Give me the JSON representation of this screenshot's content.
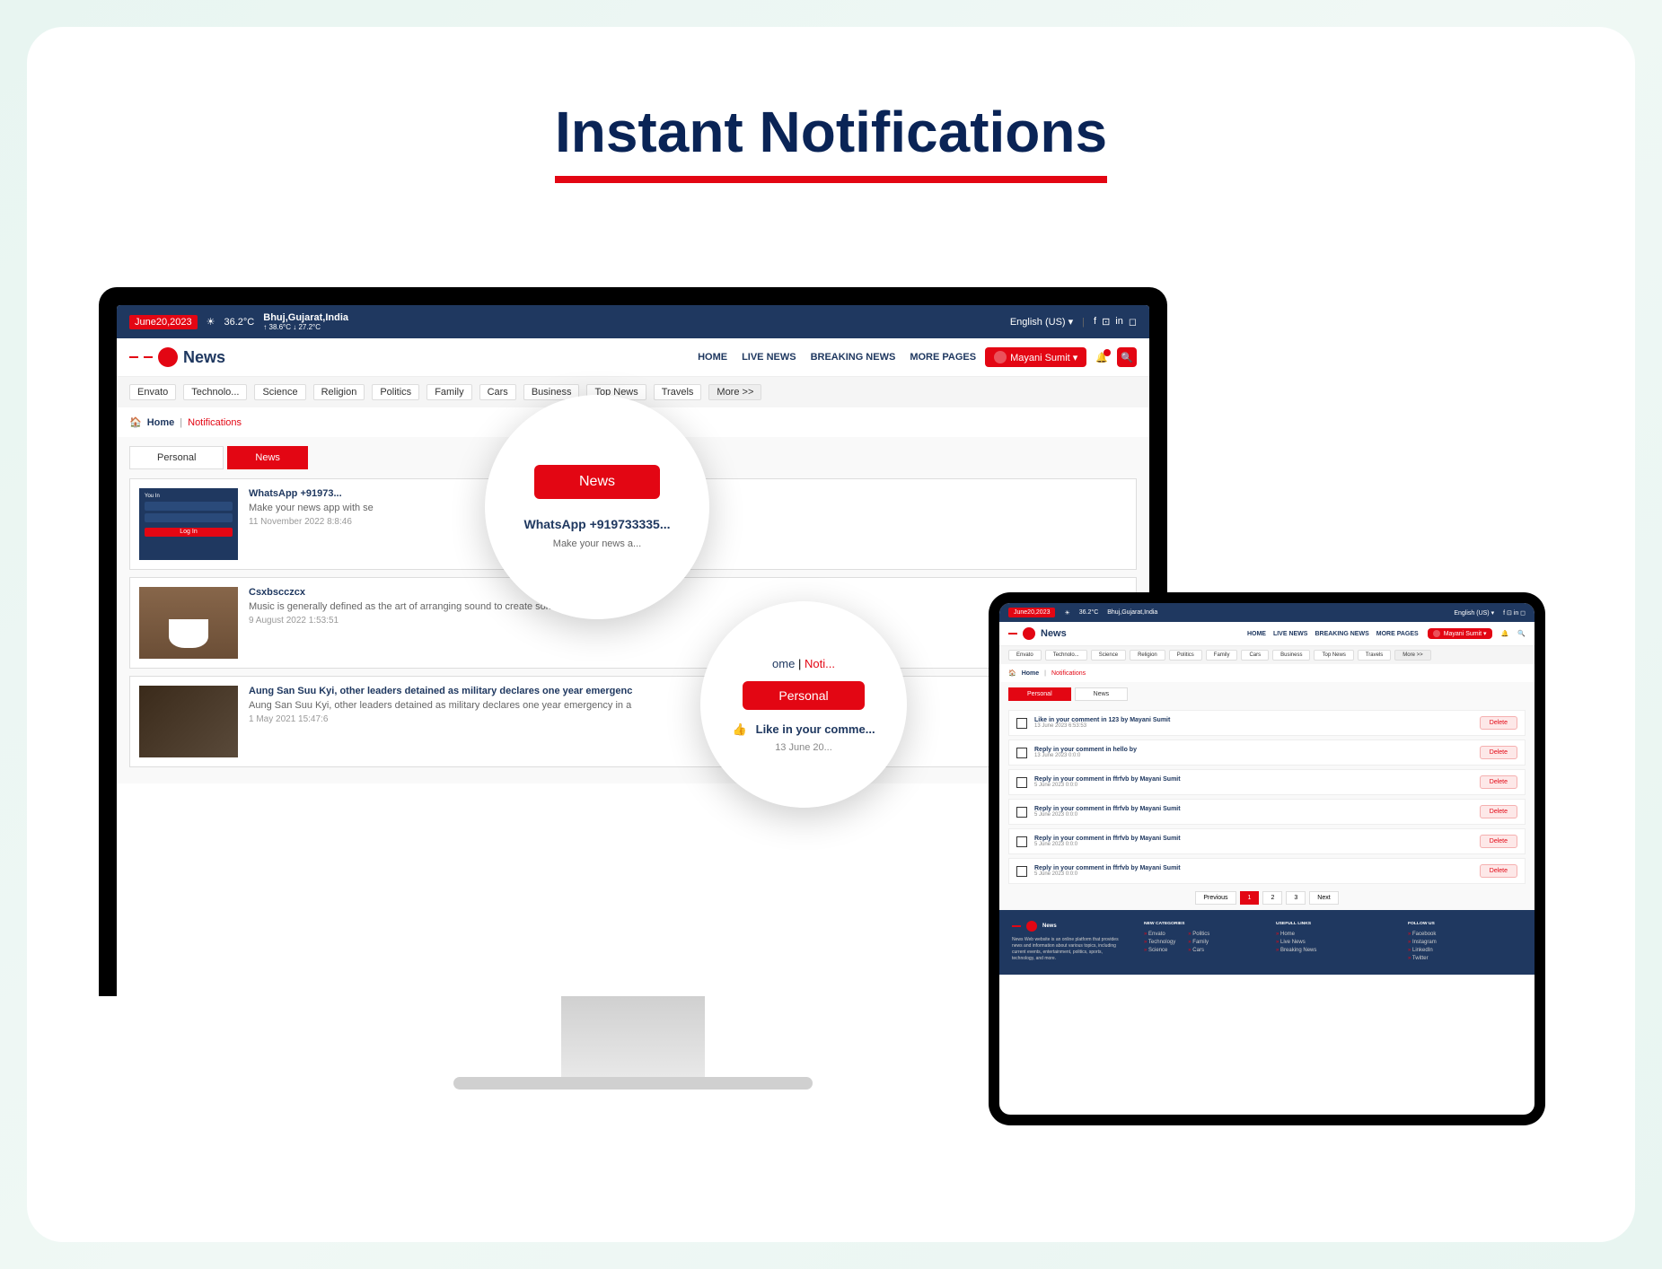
{
  "heading": "Instant Notifications",
  "topbar": {
    "date": "June20,2023",
    "temp": "36.2°C",
    "location": "Bhuj,Gujarat,India",
    "temps_detail": "↑ 38.6°C  ↓ 27.2°C",
    "language": "English (US) ▾"
  },
  "logo_text": "News",
  "nav": {
    "home": "HOME",
    "live": "LIVE NEWS",
    "breaking": "BREAKING NEWS",
    "more": "MORE PAGES"
  },
  "user": "Mayani Sumit ▾",
  "categories": [
    "Envato",
    "Technolo...",
    "Science",
    "Religion",
    "Politics",
    "Family",
    "Cars",
    "Business",
    "Top News",
    "Travels"
  ],
  "more_cat": "More >>",
  "breadcrumb": {
    "home": "Home",
    "sep": "|",
    "current": "Notifications"
  },
  "tabs": {
    "personal": "Personal",
    "news": "News"
  },
  "desktop_items": [
    {
      "title": "WhatsApp +91973...",
      "desc": "Make your news app with se",
      "date": "11 November 2022 8:8:46",
      "type": "login",
      "login_label": "Log In"
    },
    {
      "title": "Csxbscczcx",
      "desc": "Music is generally defined as the art of arranging sound to create some combination",
      "date": "9 August 2022 1:53:51",
      "type": "cup"
    },
    {
      "title": "Aung San Suu Kyi, other leaders detained as military declares one year emergenc",
      "desc": "Aung San Suu Kyi, other leaders detained as military declares one year emergency in a",
      "date": "1 May 2021 15:47:6",
      "type": "person"
    }
  ],
  "zoom1": {
    "btn": "News",
    "title": "WhatsApp +919733335...",
    "sub": "Make your news a..."
  },
  "zoom2": {
    "home": "ome",
    "sep": "|",
    "notif": "Noti...",
    "btn": "Personal",
    "row": "Like in your comme...",
    "date": "13 June 20..."
  },
  "tablet_items": [
    {
      "title": "Like in your comment in 123 by Mayani Sumit",
      "date": "13 June 2023 6:53:53"
    },
    {
      "title": "Reply in your comment in hello by",
      "date": "13 June 2023 0:0:0"
    },
    {
      "title": "Reply in your comment in ffrfvb by Mayani Sumit",
      "date": "5 June 2023 0:0:0"
    },
    {
      "title": "Reply in your comment in ffrfvb by Mayani Sumit",
      "date": "5 June 2023 0:0:0"
    },
    {
      "title": "Reply in your comment in ffrfvb by Mayani Sumit",
      "date": "5 June 2023 0:0:0"
    },
    {
      "title": "Reply in your comment in ffrfvb by Mayani Sumit",
      "date": "5 June 2023 0:0:0"
    }
  ],
  "delete_label": "Delete",
  "pagination": {
    "prev": "Previous",
    "p1": "1",
    "p2": "2",
    "p3": "3",
    "next": "Next"
  },
  "footer": {
    "about": "News Web website is an online platform that provides news and information about various topics, including current events, entertainment, politics, sports, technology, and more.",
    "cat_head": "NEW CATEGORIES",
    "cats1": [
      "Envato",
      "Technology",
      "Science"
    ],
    "cats2": [
      "Politics",
      "Family",
      "Cars"
    ],
    "links_head": "USEFULL LINKS",
    "links": [
      "Home",
      "Live News",
      "Breaking News"
    ],
    "follow_head": "FOLLOW US",
    "follows": [
      "Facebook",
      "Instagram",
      "LinkedIn",
      "Twitter"
    ]
  }
}
